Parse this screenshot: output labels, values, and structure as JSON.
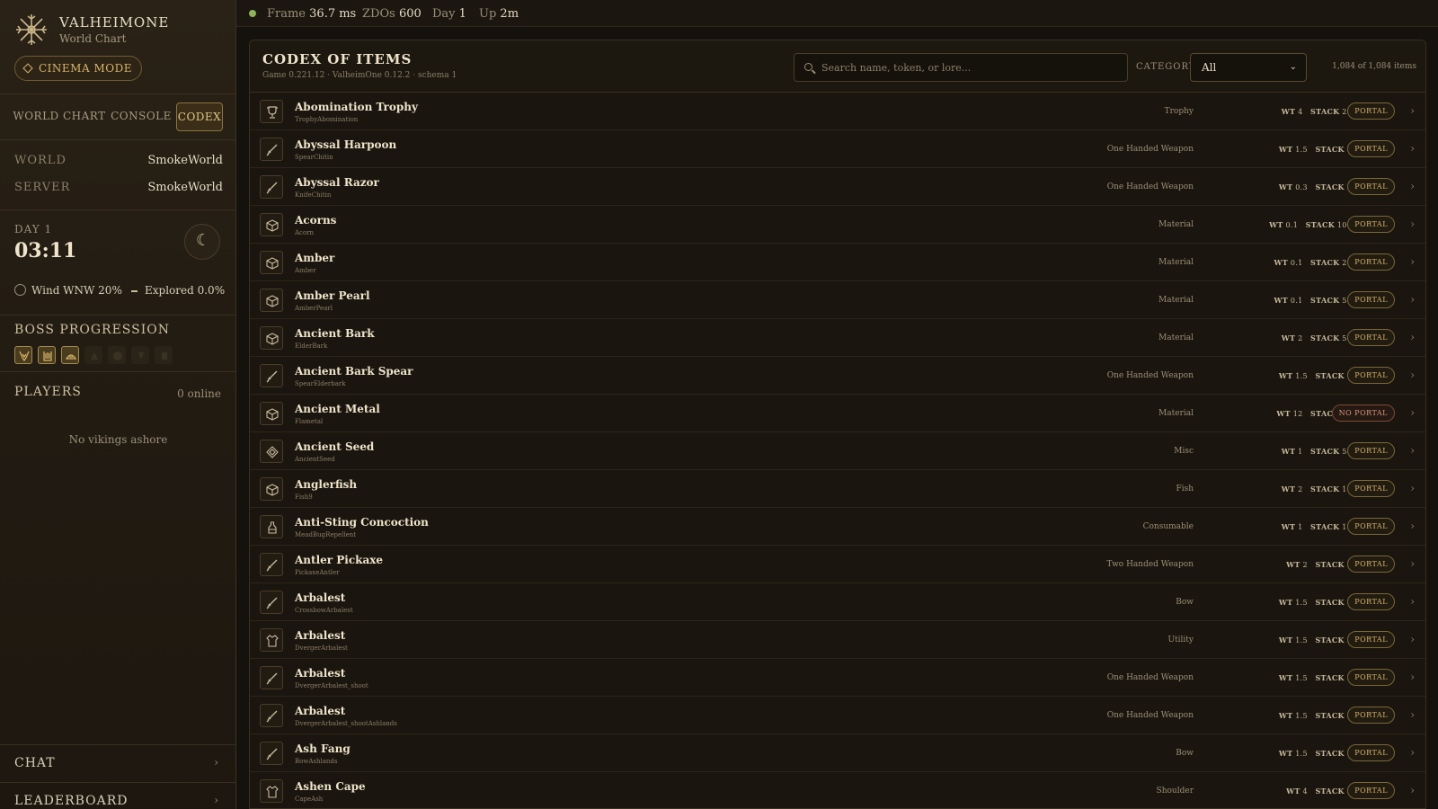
{
  "app": {
    "title": "VALHEIMONE",
    "subtitle": "World Chart",
    "cinema_label": "CINEMA MODE"
  },
  "nav": {
    "tabs": [
      "WORLD CHART",
      "CONSOLE",
      "CODEX"
    ],
    "active": "CODEX"
  },
  "world": {
    "world_label": "WORLD",
    "world_value": "SmokeWorld",
    "server_label": "SERVER",
    "server_value": "SmokeWorld"
  },
  "clock": {
    "day": "DAY 1",
    "time": "03:11",
    "moon_glyph": "☾"
  },
  "conditions": {
    "wind": "Wind WNW 20%",
    "explored": "Explored 0.0%"
  },
  "bosses": {
    "title": "BOSS PROGRESSION",
    "defeated_count": 3,
    "total": 7
  },
  "players": {
    "title": "PLAYERS",
    "count": "0 online",
    "empty": "No vikings ashore"
  },
  "drawers": {
    "chat": "CHAT",
    "leaderboard": "LEADERBOARD",
    "chev": "›"
  },
  "status": {
    "frame_label": "Frame",
    "frame_value": "36.7 ms",
    "zdos_label": "ZDOs",
    "zdos_value": "600",
    "day_label": "Day",
    "day_value": "1",
    "up_label": "Up",
    "up_value": "2m",
    "dot_color": "#8fb35a"
  },
  "codex": {
    "title": "CODEX OF ITEMS",
    "subtitle": "Game 0.221.12 · ValheimOne 0.12.2 · schema 1",
    "search_placeholder": "Search name, token, or lore...",
    "category_label": "CATEGORY",
    "category_value": "All",
    "category_arrow": "⌄",
    "count": "1,084 of 1,084 items",
    "wt_label": "WT",
    "stack_label": "STACK",
    "items": [
      {
        "name": "Abomination Trophy",
        "token": "TrophyAbomination",
        "category": "Trophy",
        "wt": "4",
        "stack": "20",
        "portal": "PORTAL",
        "icon": "trophy-icon"
      },
      {
        "name": "Abyssal Harpoon",
        "token": "SpearChitin",
        "category": "One Handed Weapon",
        "wt": "1.5",
        "stack": "1",
        "portal": "PORTAL",
        "icon": "weapon-icon"
      },
      {
        "name": "Abyssal Razor",
        "token": "KnifeChitin",
        "category": "One Handed Weapon",
        "wt": "0.3",
        "stack": "1",
        "portal": "PORTAL",
        "icon": "weapon-icon"
      },
      {
        "name": "Acorns",
        "token": "Acorn",
        "category": "Material",
        "wt": "0.1",
        "stack": "100",
        "portal": "PORTAL",
        "icon": "material-icon"
      },
      {
        "name": "Amber",
        "token": "Amber",
        "category": "Material",
        "wt": "0.1",
        "stack": "20",
        "portal": "PORTAL",
        "icon": "material-icon"
      },
      {
        "name": "Amber Pearl",
        "token": "AmberPearl",
        "category": "Material",
        "wt": "0.1",
        "stack": "50",
        "portal": "PORTAL",
        "icon": "material-icon"
      },
      {
        "name": "Ancient Bark",
        "token": "ElderBark",
        "category": "Material",
        "wt": "2",
        "stack": "50",
        "portal": "PORTAL",
        "icon": "material-icon"
      },
      {
        "name": "Ancient Bark Spear",
        "token": "SpearElderbark",
        "category": "One Handed Weapon",
        "wt": "1.5",
        "stack": "1",
        "portal": "PORTAL",
        "icon": "weapon-icon"
      },
      {
        "name": "Ancient Metal",
        "token": "Flametal",
        "category": "Material",
        "wt": "12",
        "stack": "30",
        "portal": "NO PORTAL",
        "icon": "material-icon"
      },
      {
        "name": "Ancient Seed",
        "token": "AncientSeed",
        "category": "Misc",
        "wt": "1",
        "stack": "50",
        "portal": "PORTAL",
        "icon": "misc-icon"
      },
      {
        "name": "Anglerfish",
        "token": "Fish9",
        "category": "Fish",
        "wt": "2",
        "stack": "10",
        "portal": "PORTAL",
        "icon": "material-icon"
      },
      {
        "name": "Anti-Sting Concoction",
        "token": "MeadBugRepellent",
        "category": "Consumable",
        "wt": "1",
        "stack": "10",
        "portal": "PORTAL",
        "icon": "potion-icon"
      },
      {
        "name": "Antler Pickaxe",
        "token": "PickaxeAntler",
        "category": "Two Handed Weapon",
        "wt": "2",
        "stack": "1",
        "portal": "PORTAL",
        "icon": "weapon-icon"
      },
      {
        "name": "Arbalest",
        "token": "CrossbowArbalest",
        "category": "Bow",
        "wt": "1.5",
        "stack": "1",
        "portal": "PORTAL",
        "icon": "weapon-icon"
      },
      {
        "name": "Arbalest",
        "token": "DvergerArbalest",
        "category": "Utility",
        "wt": "1.5",
        "stack": "1",
        "portal": "PORTAL",
        "icon": "armor-icon"
      },
      {
        "name": "Arbalest",
        "token": "DvergerArbalest_shoot",
        "category": "One Handed Weapon",
        "wt": "1.5",
        "stack": "1",
        "portal": "PORTAL",
        "icon": "weapon-icon"
      },
      {
        "name": "Arbalest",
        "token": "DvergerArbalest_shootAshlands",
        "category": "One Handed Weapon",
        "wt": "1.5",
        "stack": "1",
        "portal": "PORTAL",
        "icon": "weapon-icon"
      },
      {
        "name": "Ash Fang",
        "token": "BowAshlands",
        "category": "Bow",
        "wt": "1.5",
        "stack": "1",
        "portal": "PORTAL",
        "icon": "weapon-icon"
      },
      {
        "name": "Ashen Cape",
        "token": "CapeAsh",
        "category": "Shoulder",
        "wt": "4",
        "stack": "1",
        "portal": "PORTAL",
        "icon": "armor-icon"
      }
    ]
  }
}
